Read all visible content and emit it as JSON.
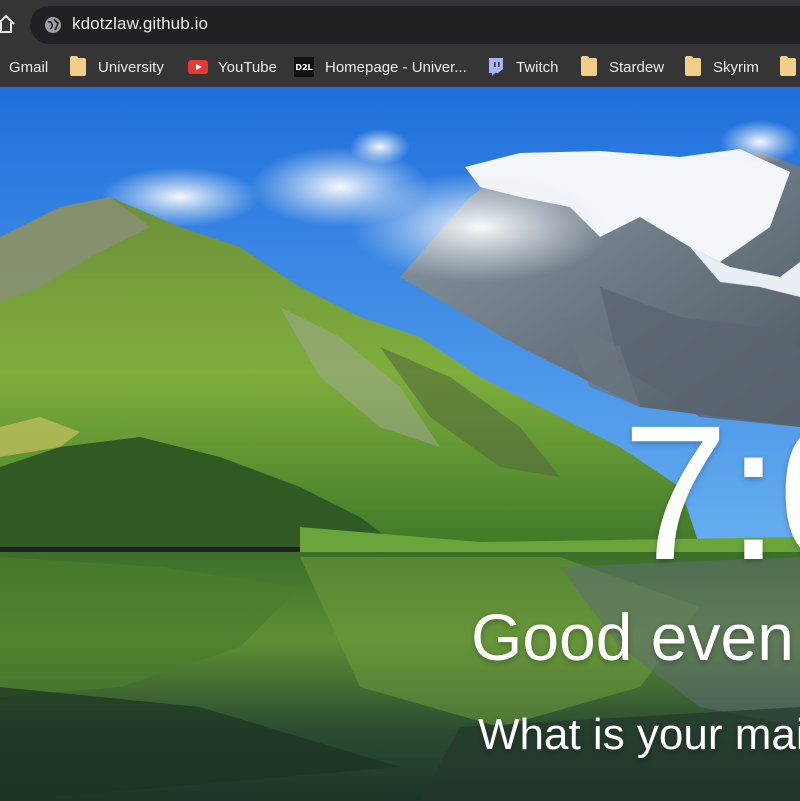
{
  "browser": {
    "url": "kdotzlaw.github.io",
    "bookmarks": [
      {
        "label": "Gmail",
        "icon": "gmail-icon"
      },
      {
        "label": "University",
        "icon": "folder-icon"
      },
      {
        "label": "YouTube",
        "icon": "youtube-icon"
      },
      {
        "label": "Homepage - Univer...",
        "icon": "d2l-icon",
        "icon_text": "D2L"
      },
      {
        "label": "Twitch",
        "icon": "twitch-icon"
      },
      {
        "label": "Stardew",
        "icon": "folder-icon"
      },
      {
        "label": "Skyrim",
        "icon": "folder-icon"
      }
    ]
  },
  "page": {
    "clock": "7:0",
    "greeting": "Good even",
    "focus_question": "What is your mai"
  },
  "colors": {
    "chrome_bg": "#353535",
    "omnibox_bg": "#202124",
    "text": "#e8eaed",
    "sky": "#2f7fe0",
    "folder": "#f1cf8a"
  }
}
